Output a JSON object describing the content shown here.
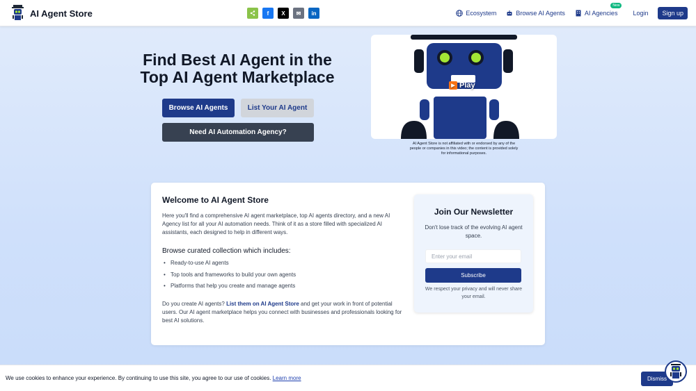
{
  "header": {
    "brand_name": "AI Agent Store",
    "share": [
      {
        "icon": "share-icon",
        "glyph": "<",
        "color": "#8bc34a"
      },
      {
        "icon": "facebook-icon",
        "glyph": "f",
        "color": "#1877f2"
      },
      {
        "icon": "x-icon",
        "glyph": "X",
        "color": "#000000"
      },
      {
        "icon": "email-icon",
        "glyph": "✉",
        "color": "#6b7280"
      },
      {
        "icon": "linkedin-icon",
        "glyph": "in",
        "color": "#0a66c2"
      }
    ],
    "nav": {
      "ecosystem": "Ecosystem",
      "browse": "Browse AI Agents",
      "agencies": "AI Agencies",
      "agencies_badge": "New",
      "login": "Login",
      "signup": "Sign up"
    }
  },
  "hero": {
    "title_line1": "Find Best AI Agent in the",
    "title_line2": "Top AI Agent Marketplace",
    "browse_button": "Browse AI Agents",
    "list_button": "List Your AI Agent",
    "agency_button": "Need AI Automation Agency?",
    "video_play": "Play",
    "disclaimer": "AI Agent Store is not affiliated with or endorsed by any of the people or companies in this video; the content is provided solely for informational purposes."
  },
  "welcome": {
    "title": "Welcome to AI Agent Store",
    "intro": "Here you'll find a comprehensive AI agent marketplace, top AI agents directory, and a new AI Agency list for all your AI automation needs. Think of it as a store filled with specialized AI assistants, each designed to help in different ways.",
    "subtitle": "Browse curated collection which includes:",
    "items": [
      "Ready-to-use AI agents",
      "Top tools and frameworks to build your own agents",
      "Platforms that help you create and manage agents"
    ],
    "outro_before": "Do you create AI agents? ",
    "outro_link": "List them on AI Agent Store",
    "outro_after": " and get your work in front of potential users. Our AI agent marketplace helps you connect with businesses and professionals looking for best AI solutions."
  },
  "newsletter": {
    "title": "Join Our Newsletter",
    "description": "Don't lose track of the evolving AI agent space.",
    "email_placeholder": "Enter your email",
    "subscribe": "Subscribe",
    "privacy": "We respect your privacy and will never share your email."
  },
  "cookie": {
    "text": "We use cookies to enhance your experience. By continuing to use this site, you agree to our use of cookies. ",
    "learn_more": "Learn more",
    "dismiss": "Dismiss"
  },
  "colors": {
    "primary": "#1e3a8a",
    "robot_body": "#1e3a8a",
    "robot_eye": "#a3e635"
  }
}
